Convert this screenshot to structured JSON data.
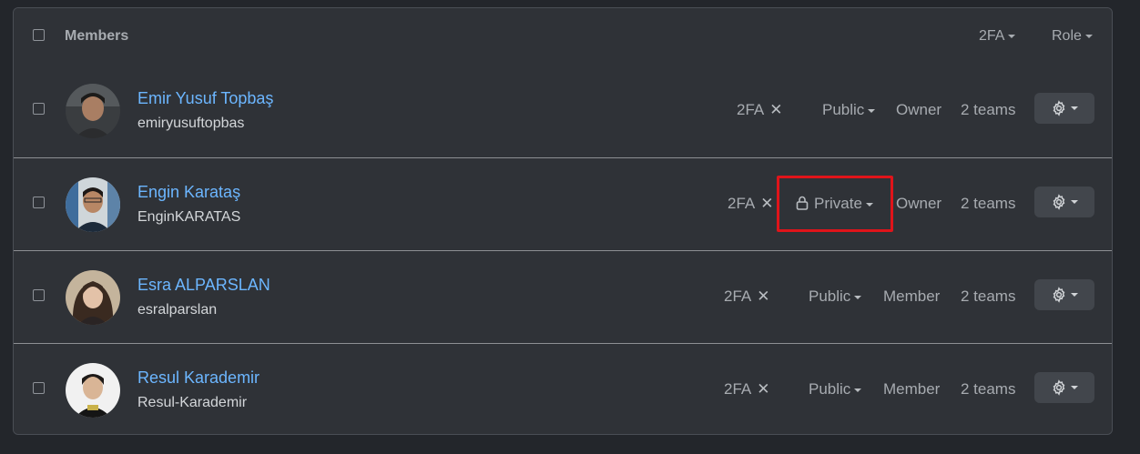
{
  "header": {
    "title": "Members",
    "filter_2fa": "2FA",
    "filter_role": "Role"
  },
  "members": [
    {
      "name": "Emir Yusuf Topbaş",
      "login": "emiryusuftopbas",
      "twofa": "2FA",
      "visibility": "Public",
      "role": "Owner",
      "teams": "2 teams"
    },
    {
      "name": "Engin Karataş",
      "login": "EnginKARATAS",
      "twofa": "2FA",
      "visibility": "Private",
      "role": "Owner",
      "teams": "2 teams"
    },
    {
      "name": "Esra ALPARSLAN",
      "login": "esralparslan",
      "twofa": "2FA",
      "visibility": "Public",
      "role": "Member",
      "teams": "2 teams"
    },
    {
      "name": "Resul Karademir",
      "login": "Resul-Karademir",
      "twofa": "2FA",
      "visibility": "Public",
      "role": "Member",
      "teams": "2 teams"
    }
  ],
  "icons": {
    "twofa_status": "x-icon",
    "private_visibility": "lock-icon",
    "actions": "gear-icon"
  },
  "colors": {
    "link": "#6cb6ff",
    "highlight": "#e0141a"
  }
}
